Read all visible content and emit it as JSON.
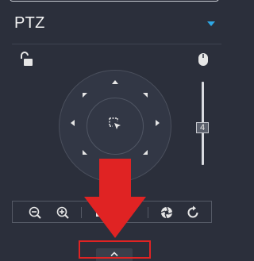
{
  "panel": {
    "title": "PTZ"
  },
  "zoom_slider": {
    "value": "4"
  },
  "colors": {
    "accent": "#2ea8e6",
    "annotation": "#e02323",
    "background": "#2b2f3b"
  },
  "icons": {
    "collapse": "triangle-down-icon",
    "lock": "unlock-icon",
    "mouse": "mouse-icon",
    "center": "select-pointer-icon",
    "zoom_out": "zoom-out-icon",
    "zoom_in": "zoom-in-icon",
    "focus": "focus-icon",
    "iris": "aperture-icon",
    "refresh": "refresh-icon",
    "expand": "chevron-up-icon"
  }
}
